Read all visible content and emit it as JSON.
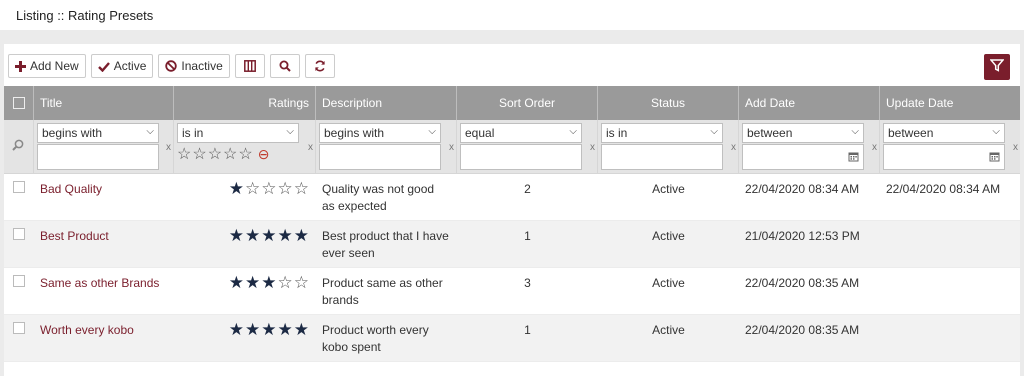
{
  "page_title": "Listing :: Rating Presets",
  "toolbar": {
    "add_new": "Add New",
    "active": "Active",
    "inactive": "Inactive"
  },
  "icons": {
    "add": "plus-icon",
    "active": "check-icon",
    "inactive": "ban-icon",
    "columns": "columns-icon",
    "search": "search-icon",
    "refresh": "refresh-icon",
    "filter": "funnel-icon"
  },
  "colors": {
    "accent": "#7a1e2c",
    "header_bg": "#9a9a9a",
    "star": "#1c2a44"
  },
  "columns": [
    "Title",
    "Ratings",
    "Description",
    "Sort Order",
    "Status",
    "Add Date",
    "Update Date"
  ],
  "filters": {
    "title": "begins with",
    "ratings": "is in",
    "description": "begins with",
    "sort_order": "equal",
    "status": "is in",
    "add_date": "between",
    "update_date": "between",
    "clear": "x"
  },
  "rows": [
    {
      "title": "Bad Quality",
      "rating": 1,
      "description": "Quality was not good as expected",
      "sort_order": "2",
      "status": "Active",
      "add_date": "22/04/2020 08:34 AM",
      "update_date": "22/04/2020 08:34 AM"
    },
    {
      "title": "Best Product",
      "rating": 5,
      "description": "Best product that I have ever seen",
      "sort_order": "1",
      "status": "Active",
      "add_date": "21/04/2020 12:53 PM",
      "update_date": ""
    },
    {
      "title": "Same as other Brands",
      "rating": 3,
      "description": "Product same as other brands",
      "sort_order": "3",
      "status": "Active",
      "add_date": "22/04/2020 08:35 AM",
      "update_date": ""
    },
    {
      "title": "Worth every kobo",
      "rating": 5,
      "description": "Product worth every kobo spent",
      "sort_order": "1",
      "status": "Active",
      "add_date": "22/04/2020 08:35 AM",
      "update_date": ""
    }
  ]
}
